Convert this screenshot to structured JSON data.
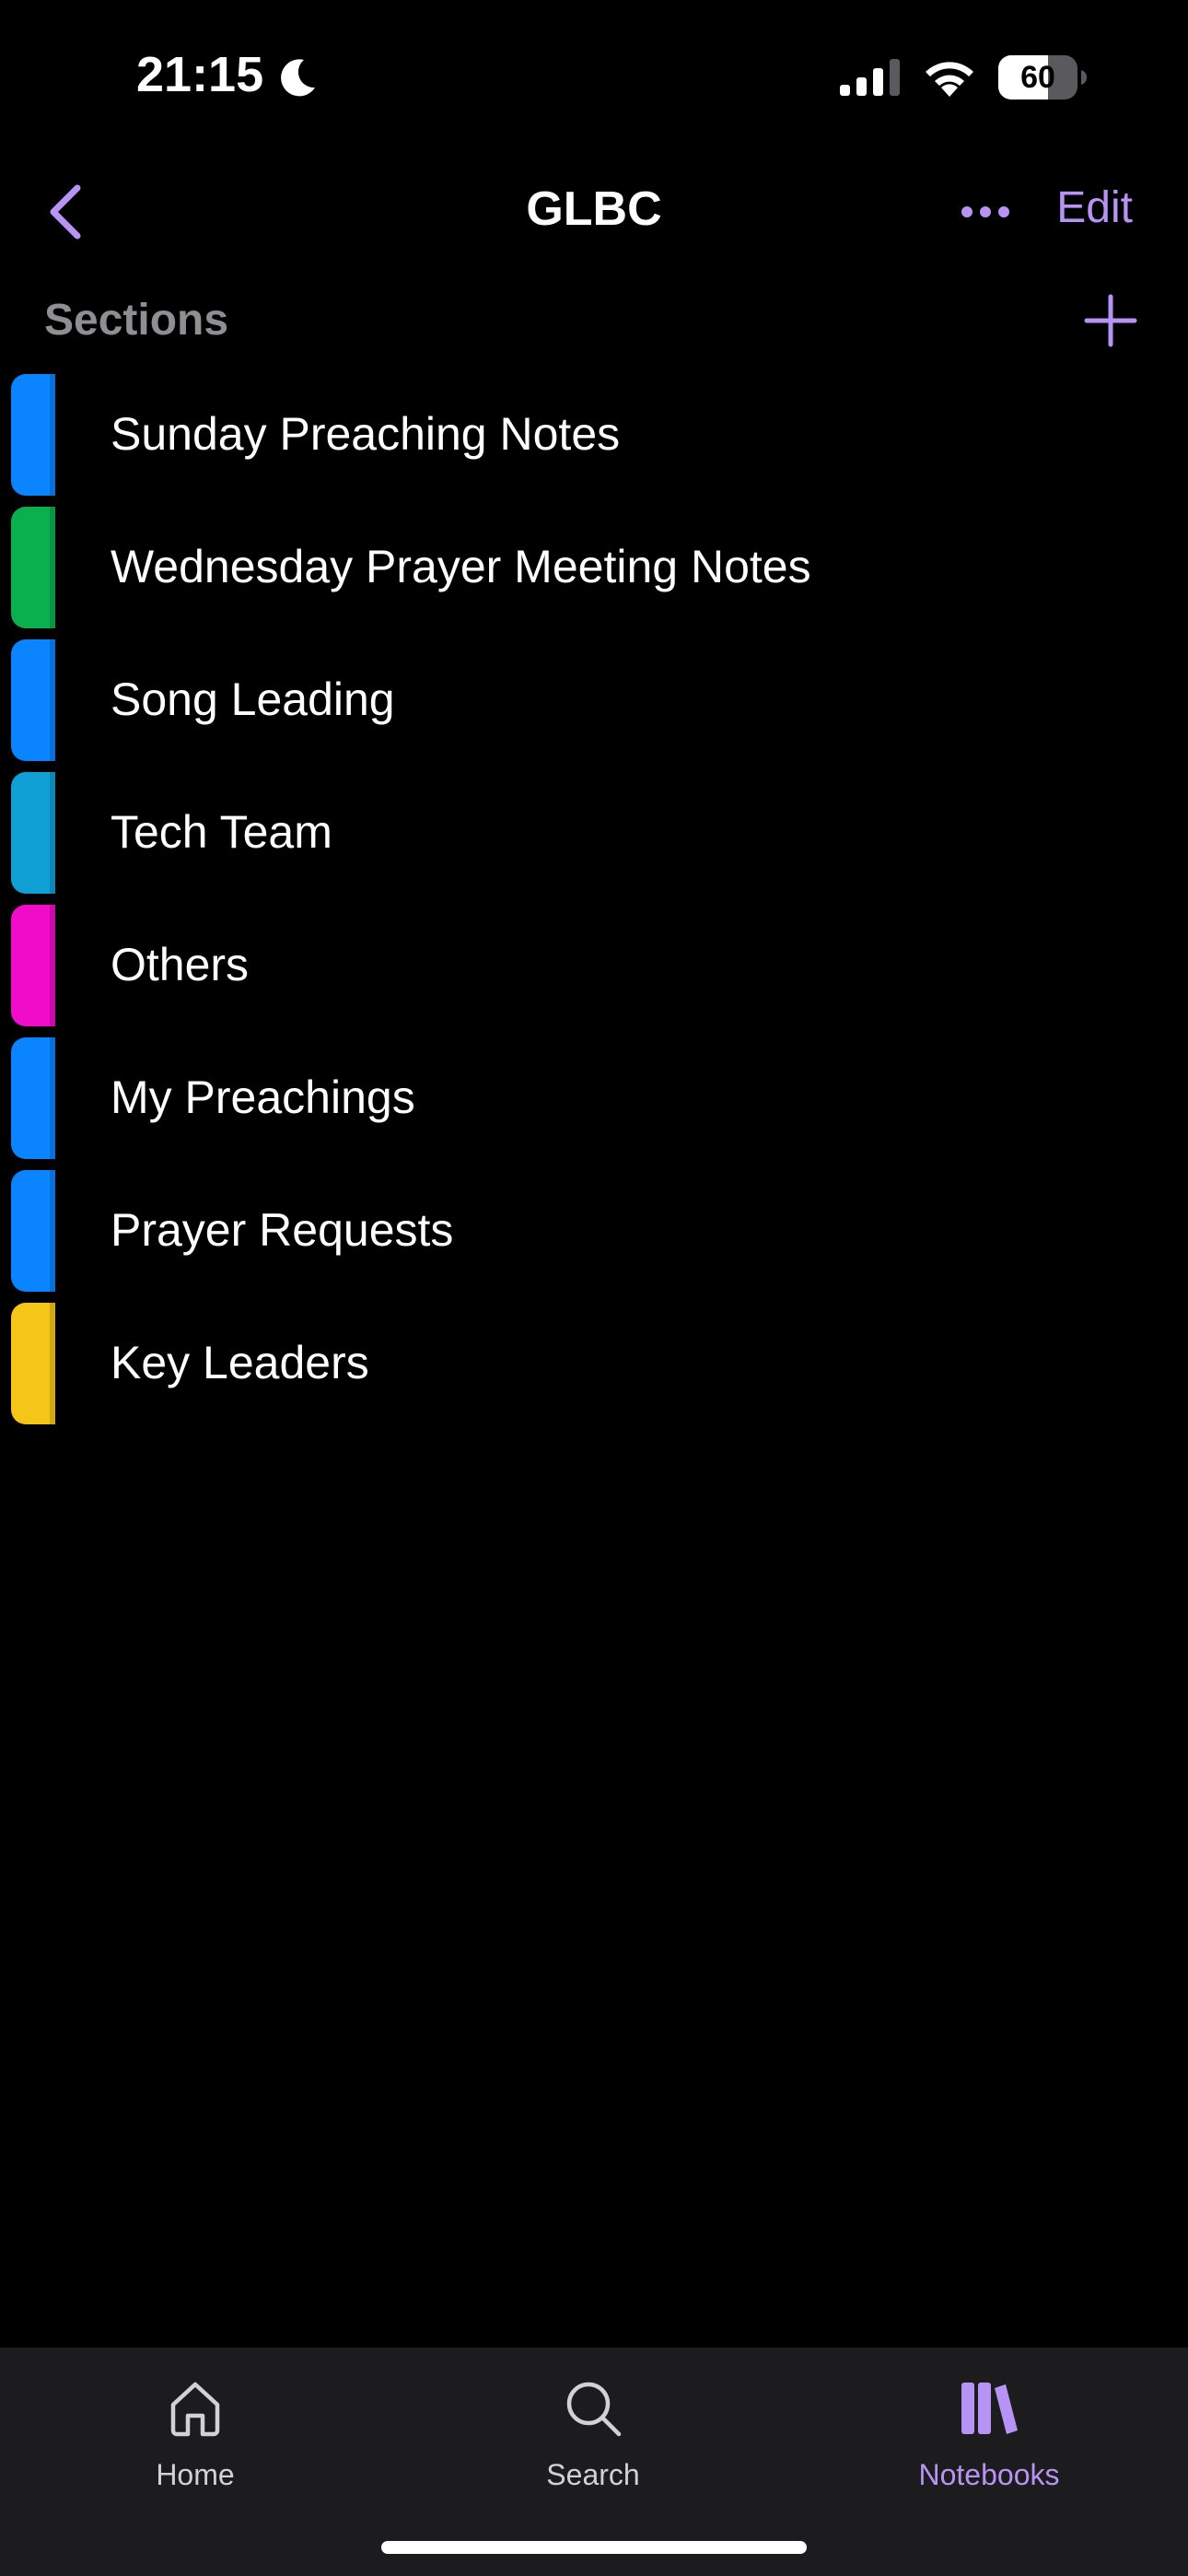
{
  "status_bar": {
    "time": "21:15",
    "battery": "60",
    "icons": [
      "moon-icon",
      "cellular-signal-icon",
      "wifi-icon",
      "battery-icon"
    ]
  },
  "nav": {
    "title": "GLBC",
    "edit_label": "Edit",
    "icons": [
      "back-chevron-icon",
      "more-dots-icon"
    ],
    "accent_color": "#b794f4"
  },
  "sections": {
    "header_label": "Sections",
    "add_icon": "plus-icon",
    "items": [
      {
        "label": "Sunday Preaching Notes",
        "color": "#0a84ff"
      },
      {
        "label": "Wednesday Prayer Meeting Notes",
        "color": "#0ab04e"
      },
      {
        "label": "Song Leading",
        "color": "#0a84ff"
      },
      {
        "label": "Tech Team",
        "color": "#10a0d6"
      },
      {
        "label": "Others",
        "color": "#f00cc8"
      },
      {
        "label": "My Preachings",
        "color": "#0a84ff"
      },
      {
        "label": "Prayer Requests",
        "color": "#0a84ff"
      },
      {
        "label": "Key Leaders",
        "color": "#f5c518"
      }
    ]
  },
  "tab_bar": {
    "tabs": [
      {
        "label": "Home",
        "icon": "home-icon",
        "active": false
      },
      {
        "label": "Search",
        "icon": "search-icon",
        "active": false
      },
      {
        "label": "Notebooks",
        "icon": "notebooks-icon",
        "active": true
      }
    ]
  }
}
